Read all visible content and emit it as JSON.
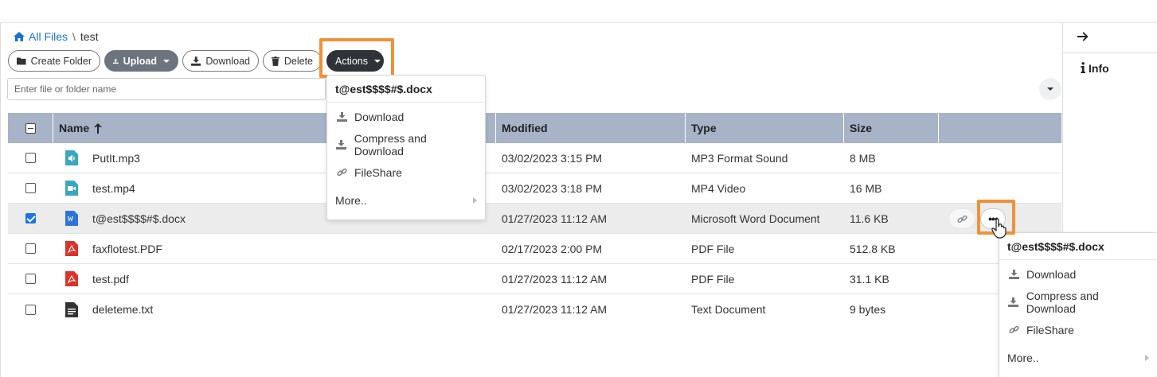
{
  "breadcrumb": {
    "root": "All Files",
    "separator": "\\",
    "current": "test"
  },
  "toolbar": {
    "create_folder": "Create Folder",
    "upload": "Upload",
    "download": "Download",
    "delete": "Delete",
    "actions": "Actions"
  },
  "search": {
    "placeholder": "Enter file or folder name"
  },
  "table": {
    "headers": {
      "name": "Name",
      "modified": "Modified",
      "type": "Type",
      "size": "Size"
    },
    "rows": [
      {
        "name": "PutIt.mp3",
        "modified": "03/02/2023 3:15 PM",
        "type": "MP3 Format Sound",
        "size": "8 MB",
        "icon": "audio-file-icon"
      },
      {
        "name": "test.mp4",
        "modified": "03/02/2023 3:18 PM",
        "type": "MP4 Video",
        "size": "16 MB",
        "icon": "video-file-icon"
      },
      {
        "name": "t@est$$$$#$.docx",
        "modified": "01/27/2023 11:12 AM",
        "type": "Microsoft Word Document",
        "size": "11.6 KB",
        "icon": "word-file-icon"
      },
      {
        "name": "faxflotest.PDF",
        "modified": "02/17/2023 2:00 PM",
        "type": "PDF File",
        "size": "512.8 KB",
        "icon": "pdf-file-icon"
      },
      {
        "name": "test.pdf",
        "modified": "01/27/2023 11:12 AM",
        "type": "PDF File",
        "size": "31.1 KB",
        "icon": "pdf-file-icon"
      },
      {
        "name": "deleteme.txt",
        "modified": "01/27/2023 11:12 AM",
        "type": "Text Document",
        "size": "9 bytes",
        "icon": "text-file-icon"
      }
    ]
  },
  "row_actions": {
    "more": "•••"
  },
  "side_panel": {
    "info": "Info"
  },
  "actions_menu": {
    "title": "t@est$$$$#$.docx",
    "items": [
      "Download",
      "Compress and Download",
      "FileShare",
      "More.."
    ]
  },
  "context_menu": {
    "title": "t@est$$$$#$.docx",
    "items": [
      "Download",
      "Compress and Download",
      "FileShare",
      "More.."
    ]
  },
  "colors": {
    "accent": "#1a73c9",
    "header_bg": "#a8b3c8",
    "highlight": "#f0913a",
    "actions_btn": "#2f3338",
    "upload_btn": "#6c757d"
  }
}
